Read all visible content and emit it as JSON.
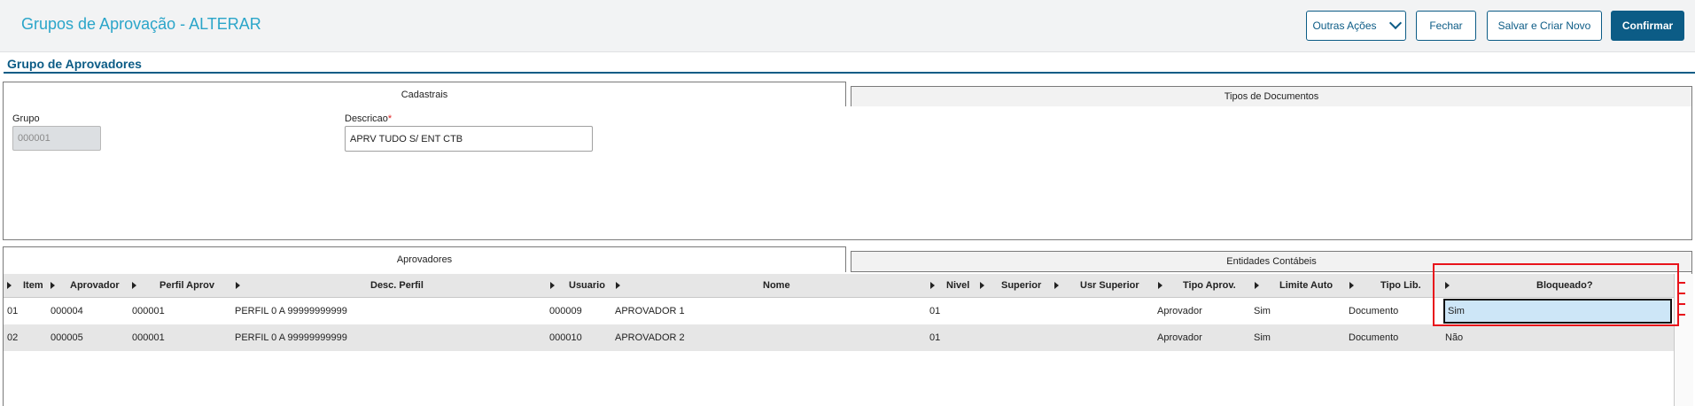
{
  "header": {
    "title": "Grupos de Aprovação - ALTERAR",
    "buttons": {
      "outras_acoes": "Outras Ações",
      "fechar": "Fechar",
      "salvar_criar_novo": "Salvar e Criar Novo",
      "confirmar": "Confirmar"
    }
  },
  "section_title": "Grupo de Aprovadores",
  "top_tabs": [
    "Cadastrais",
    "Tipos de Documentos"
  ],
  "form": {
    "grupo_label": "Grupo",
    "grupo_value": "000001",
    "descricao_label": "Descricao",
    "descricao_required": "*",
    "descricao_value": "APRV TUDO S/ ENT CTB"
  },
  "bottom_tabs": [
    "Aprovadores",
    "Entidades Contábeis"
  ],
  "grid": {
    "columns": [
      "Item",
      "Aprovador",
      "Perfil Aprov",
      "Desc. Perfil",
      "Usuario",
      "Nome",
      "Nivel",
      "Superior",
      "Usr Superior",
      "Tipo Aprov.",
      "Limite Auto",
      "Tipo Lib.",
      "Bloqueado?"
    ],
    "rows": [
      [
        "01",
        "000004",
        "000001",
        "PERFIL 0 A 99999999999",
        "000009",
        "APROVADOR 1",
        "01",
        "",
        "",
        "Aprovador",
        "Sim",
        "Documento",
        "Sim"
      ],
      [
        "02",
        "000005",
        "000001",
        "PERFIL 0 A 99999999999",
        "000010",
        "APROVADOR 2",
        "01",
        "",
        "",
        "Aprovador",
        "Sim",
        "Documento",
        "Não"
      ]
    ],
    "selected_row": 0,
    "selected_column": "Bloqueado?"
  },
  "colors": {
    "brand": "#0c5c86",
    "title": "#2aa5c9",
    "highlight": "#e8131b",
    "selected_cell": "#cde6f7",
    "row_alt": "#e6e6e6"
  },
  "icons": [
    "chevron-down-icon",
    "column-arrow-icon"
  ]
}
